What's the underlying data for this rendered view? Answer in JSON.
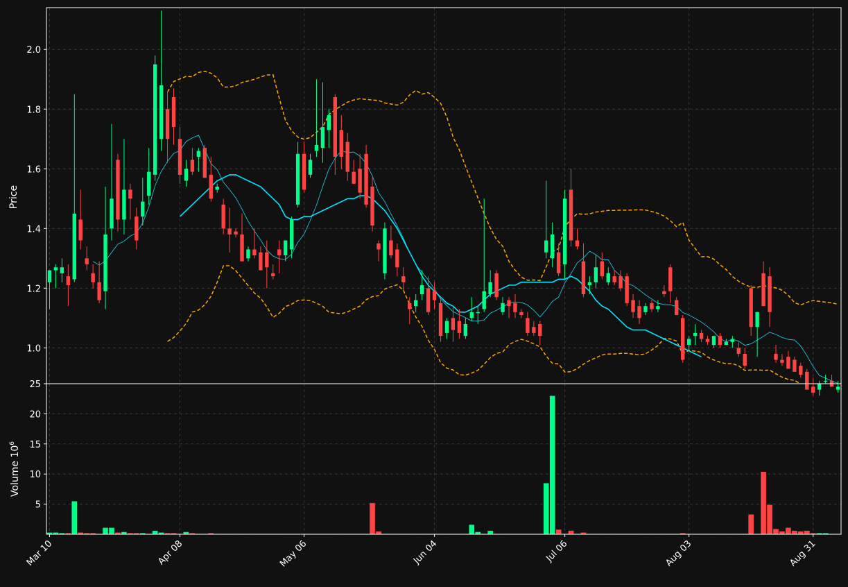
{
  "colors": {
    "background": "#111111",
    "up": "#00ff88",
    "down": "#ff4444",
    "frame": "#ffffff",
    "grid": "#3a3a3a",
    "sma_fast": "#22d3ee",
    "sma_slow": "#00e5ff",
    "bands": "#ffa500"
  },
  "chart_data": {
    "type": "candlestick",
    "grid": true,
    "price_panel": {
      "ylabel": "Price",
      "ylim": [
        0.88,
        2.14
      ],
      "ticks": [
        "1.0",
        "1.2",
        "1.4",
        "1.6",
        "1.8",
        "2.0"
      ]
    },
    "volume_panel": {
      "ylabel": "Volume  10",
      "ylabel_exponent": "6",
      "ylim": [
        0,
        25
      ],
      "ticks": [
        "5",
        "10",
        "15",
        "20",
        "25"
      ]
    },
    "x_tick_labels": [
      {
        "label": "Mar 10",
        "index": 0
      },
      {
        "label": "Apr 08",
        "index": 21
      },
      {
        "label": "May 06",
        "index": 41
      },
      {
        "label": "Jun 04",
        "index": 62
      },
      {
        "label": "Jul 06",
        "index": 83
      },
      {
        "label": "Aug 03",
        "index": 103
      },
      {
        "label": "Aug 31",
        "index": 123
      }
    ],
    "candles": [
      [
        1.22,
        1.26,
        1.13,
        1.26,
        0.3
      ],
      [
        1.26,
        1.28,
        1.2,
        1.27,
        0.3
      ],
      [
        1.25,
        1.3,
        1.22,
        1.27,
        0.2
      ],
      [
        1.24,
        1.28,
        1.14,
        1.21,
        0.2
      ],
      [
        1.23,
        1.85,
        1.22,
        1.45,
        5.5
      ],
      [
        1.43,
        1.53,
        1.33,
        1.36,
        0.3
      ],
      [
        1.3,
        1.34,
        1.26,
        1.28,
        0.2
      ],
      [
        1.25,
        1.28,
        1.2,
        1.22,
        0.2
      ],
      [
        1.22,
        1.29,
        1.15,
        1.16,
        0.1
      ],
      [
        1.19,
        1.54,
        1.13,
        1.38,
        1.1
      ],
      [
        1.4,
        1.75,
        1.36,
        1.5,
        1.1
      ],
      [
        1.63,
        1.65,
        1.39,
        1.43,
        0.3
      ],
      [
        1.43,
        1.7,
        1.38,
        1.53,
        0.4
      ],
      [
        1.53,
        1.55,
        1.43,
        1.5,
        0.2
      ],
      [
        1.44,
        1.47,
        1.33,
        1.36,
        0.2
      ],
      [
        1.44,
        1.57,
        1.41,
        1.49,
        0.2
      ],
      [
        1.51,
        1.67,
        1.48,
        1.59,
        0.1
      ],
      [
        1.58,
        1.98,
        1.56,
        1.95,
        0.6
      ],
      [
        1.7,
        2.13,
        1.66,
        1.88,
        0.3
      ],
      [
        1.8,
        1.86,
        1.62,
        1.7,
        0.2
      ],
      [
        1.84,
        1.87,
        1.68,
        1.74,
        0.2
      ],
      [
        1.7,
        1.74,
        1.55,
        1.58,
        0.1
      ],
      [
        1.56,
        1.63,
        1.54,
        1.6,
        0.4
      ],
      [
        1.63,
        1.67,
        1.58,
        1.59,
        0.2
      ],
      [
        1.64,
        1.67,
        1.59,
        1.66,
        0.1
      ],
      [
        1.67,
        1.68,
        1.57,
        1.57,
        0.1
      ],
      [
        1.58,
        1.64,
        1.49,
        1.5,
        0.2
      ],
      [
        1.53,
        1.55,
        1.52,
        1.54,
        0.1
      ],
      [
        1.48,
        1.5,
        1.38,
        1.4,
        0.1
      ],
      [
        1.4,
        1.47,
        1.32,
        1.38,
        0.1
      ],
      [
        1.39,
        1.4,
        1.37,
        1.38,
        0.1
      ],
      [
        1.38,
        1.45,
        1.29,
        1.29,
        0.1
      ],
      [
        1.3,
        1.34,
        1.29,
        1.33,
        0.1
      ],
      [
        1.33,
        1.4,
        1.3,
        1.31,
        0.1
      ],
      [
        1.32,
        1.34,
        1.26,
        1.26,
        0.1
      ],
      [
        1.32,
        1.36,
        1.2,
        1.27,
        0.1
      ],
      [
        1.25,
        1.28,
        1.23,
        1.24,
        0.1
      ],
      [
        1.33,
        1.36,
        1.25,
        1.31,
        0.1
      ],
      [
        1.31,
        1.35,
        1.29,
        1.36,
        0.1
      ],
      [
        1.33,
        1.44,
        1.3,
        1.43,
        0.1
      ],
      [
        1.48,
        1.69,
        1.47,
        1.65,
        0.1
      ],
      [
        1.65,
        1.69,
        1.52,
        1.53,
        0.1
      ],
      [
        1.58,
        1.65,
        1.57,
        1.63,
        0.1
      ],
      [
        1.66,
        1.9,
        1.64,
        1.68,
        0.1
      ],
      [
        1.67,
        1.89,
        1.62,
        1.74,
        0.1
      ],
      [
        1.73,
        1.8,
        1.67,
        1.78,
        0.1
      ],
      [
        1.84,
        1.85,
        1.58,
        1.64,
        0.1
      ],
      [
        1.73,
        1.78,
        1.6,
        1.64,
        0.1
      ],
      [
        1.69,
        1.72,
        1.56,
        1.59,
        0.1
      ],
      [
        1.59,
        1.63,
        1.55,
        1.55,
        0.1
      ],
      [
        1.6,
        1.65,
        1.5,
        1.52,
        0.1
      ],
      [
        1.65,
        1.68,
        1.47,
        1.48,
        0.1
      ],
      [
        1.54,
        1.57,
        1.39,
        1.41,
        5.2
      ],
      [
        1.35,
        1.36,
        1.29,
        1.33,
        0.5
      ],
      [
        1.25,
        1.42,
        1.23,
        1.4,
        0.1
      ],
      [
        1.36,
        1.41,
        1.3,
        1.31,
        0.1
      ],
      [
        1.33,
        1.35,
        1.24,
        1.27,
        0.1
      ],
      [
        1.24,
        1.27,
        1.19,
        1.22,
        0.1
      ],
      [
        1.15,
        1.17,
        1.08,
        1.13,
        0.1
      ],
      [
        1.14,
        1.18,
        1.12,
        1.16,
        0.1
      ],
      [
        1.18,
        1.26,
        1.16,
        1.21,
        0.1
      ],
      [
        1.2,
        1.24,
        1.11,
        1.12,
        0.1
      ],
      [
        1.19,
        1.22,
        1.13,
        1.16,
        0.1
      ],
      [
        1.15,
        1.17,
        1.02,
        1.04,
        0.1
      ],
      [
        1.05,
        1.1,
        1.03,
        1.09,
        0.1
      ],
      [
        1.1,
        1.14,
        1.02,
        1.06,
        0.1
      ],
      [
        1.09,
        1.13,
        1.03,
        1.05,
        0.1
      ],
      [
        1.04,
        1.1,
        1.03,
        1.08,
        0.1
      ],
      [
        1.1,
        1.17,
        1.09,
        1.12,
        1.6
      ],
      [
        1.12,
        1.14,
        1.08,
        1.12,
        0.4
      ],
      [
        1.13,
        1.5,
        1.12,
        1.19,
        0.1
      ],
      [
        1.18,
        1.26,
        1.17,
        1.22,
        0.6
      ],
      [
        1.25,
        1.26,
        1.16,
        1.17,
        0.1
      ],
      [
        1.12,
        1.17,
        1.11,
        1.15,
        0.1
      ],
      [
        1.16,
        1.17,
        1.1,
        1.14,
        0.1
      ],
      [
        1.15,
        1.18,
        1.1,
        1.12,
        0.1
      ],
      [
        1.12,
        1.13,
        1.1,
        1.11,
        0.1
      ],
      [
        1.1,
        1.12,
        1.04,
        1.05,
        0.1
      ],
      [
        1.07,
        1.09,
        1.04,
        1.05,
        0.1
      ],
      [
        1.08,
        1.09,
        1.01,
        1.04,
        0.1
      ],
      [
        1.32,
        1.56,
        1.3,
        1.36,
        8.5
      ],
      [
        1.3,
        1.42,
        1.27,
        1.38,
        23.0
      ],
      [
        1.32,
        1.35,
        1.24,
        1.25,
        0.8
      ],
      [
        1.28,
        1.53,
        1.23,
        1.5,
        0.1
      ],
      [
        1.53,
        1.6,
        1.34,
        1.36,
        0.6
      ],
      [
        1.36,
        1.4,
        1.33,
        1.34,
        0.1
      ],
      [
        1.29,
        1.35,
        1.17,
        1.18,
        0.3
      ],
      [
        1.21,
        1.24,
        1.18,
        1.22,
        0.1
      ],
      [
        1.22,
        1.31,
        1.2,
        1.27,
        0.1
      ],
      [
        1.29,
        1.32,
        1.23,
        1.24,
        0.1
      ],
      [
        1.22,
        1.27,
        1.21,
        1.25,
        0.1
      ],
      [
        1.24,
        1.26,
        1.21,
        1.22,
        0.1
      ],
      [
        1.24,
        1.26,
        1.19,
        1.2,
        0.1
      ],
      [
        1.24,
        1.25,
        1.14,
        1.15,
        0.1
      ],
      [
        1.16,
        1.18,
        1.1,
        1.12,
        0.1
      ],
      [
        1.14,
        1.16,
        1.08,
        1.1,
        0.1
      ],
      [
        1.12,
        1.15,
        1.11,
        1.14,
        0.1
      ],
      [
        1.15,
        1.16,
        1.12,
        1.13,
        0.1
      ],
      [
        1.13,
        1.16,
        1.12,
        1.14,
        0.1
      ],
      [
        1.19,
        1.21,
        1.17,
        1.18,
        0.1
      ],
      [
        1.27,
        1.28,
        1.15,
        1.19,
        0.1
      ],
      [
        1.16,
        1.17,
        1.11,
        1.11,
        0.1
      ],
      [
        1.1,
        1.11,
        0.95,
        0.96,
        0.2
      ],
      [
        1.01,
        1.04,
        0.99,
        1.03,
        0.1
      ],
      [
        1.04,
        1.08,
        1.01,
        1.05,
        0.1
      ],
      [
        1.05,
        1.06,
        1.02,
        1.03,
        0.1
      ],
      [
        1.03,
        1.04,
        1.01,
        1.02,
        0.1
      ],
      [
        1.01,
        1.04,
        1.0,
        1.04,
        0.1
      ],
      [
        1.04,
        1.05,
        1.0,
        1.01,
        0.1
      ],
      [
        1.01,
        1.03,
        1.01,
        1.02,
        0.1
      ],
      [
        1.02,
        1.04,
        1.0,
        1.03,
        0.1
      ],
      [
        1.0,
        1.02,
        0.97,
        0.98,
        0.1
      ],
      [
        0.98,
        1.0,
        0.93,
        0.94,
        0.1
      ],
      [
        1.2,
        1.21,
        1.04,
        1.07,
        3.3
      ],
      [
        1.07,
        1.12,
        0.97,
        1.12,
        0.1
      ],
      [
        1.25,
        1.29,
        1.14,
        1.14,
        10.4
      ],
      [
        1.24,
        1.27,
        1.07,
        1.12,
        4.9
      ],
      [
        0.98,
        1.01,
        0.95,
        0.96,
        0.9
      ],
      [
        0.96,
        0.98,
        0.94,
        0.95,
        0.5
      ],
      [
        0.97,
        0.99,
        0.93,
        0.93,
        1.1
      ],
      [
        0.96,
        0.97,
        0.92,
        0.92,
        0.6
      ],
      [
        0.94,
        0.95,
        0.9,
        0.91,
        0.5
      ],
      [
        0.92,
        0.93,
        0.86,
        0.86,
        0.6
      ],
      [
        0.87,
        0.9,
        0.84,
        0.85,
        0.2
      ],
      [
        0.86,
        0.89,
        0.84,
        0.88,
        0.2
      ],
      [
        0.89,
        0.91,
        0.88,
        0.89,
        0.2
      ],
      [
        0.89,
        0.91,
        0.87,
        0.87,
        0.1
      ],
      [
        0.86,
        0.89,
        0.85,
        0.87,
        0.1
      ]
    ],
    "sma_slow": [
      null,
      null,
      null,
      null,
      null,
      null,
      null,
      null,
      null,
      null,
      null,
      null,
      null,
      null,
      null,
      null,
      null,
      null,
      null,
      null,
      null,
      1.44,
      1.46,
      1.48,
      1.5,
      1.52,
      1.54,
      1.56,
      1.57,
      1.58,
      1.58,
      1.57,
      1.56,
      1.55,
      1.54,
      1.52,
      1.5,
      1.48,
      1.44,
      1.43,
      1.43,
      1.44,
      1.44,
      1.45,
      1.46,
      1.47,
      1.48,
      1.49,
      1.5,
      1.5,
      1.51,
      1.51,
      1.5,
      1.48,
      1.46,
      1.43,
      1.4,
      1.36,
      1.32,
      1.28,
      1.24,
      1.21,
      1.19,
      1.17,
      1.15,
      1.14,
      1.12,
      1.12,
      1.13,
      1.14,
      1.16,
      1.18,
      1.19,
      1.2,
      1.21,
      1.21,
      1.22,
      1.22,
      1.22,
      1.22,
      1.22,
      1.22,
      1.23,
      1.23,
      1.24,
      1.23,
      1.21,
      1.19,
      1.16,
      1.14,
      1.13,
      1.11,
      1.09,
      1.07,
      1.06,
      1.06,
      1.06,
      1.05,
      1.04,
      1.03,
      1.02,
      1.01,
      1.0,
      0.99,
      0.98,
      0.97
    ]
  }
}
